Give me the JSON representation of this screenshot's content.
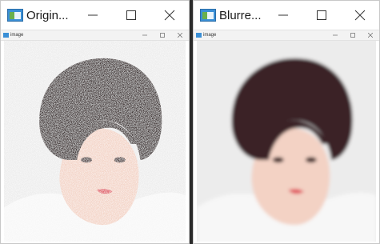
{
  "windows": [
    {
      "title": "Origin...",
      "inner_title": "image",
      "image": {
        "blurred": false
      }
    },
    {
      "title": "Blurre...",
      "inner_title": "image",
      "image": {
        "blurred": true
      }
    }
  ],
  "icons": {
    "app": "app-window-icon",
    "minimize": "minimize-icon",
    "maximize": "maximize-icon",
    "close": "close-icon"
  },
  "colors": {
    "titlebar_bg": "#ffffff",
    "background": "#2b2b2b",
    "photo_bg": "#ececec",
    "hair": "#2a1d1d",
    "skin": "#f3d2c4",
    "shirt": "#f7f7f7",
    "lips": "#e0505a"
  }
}
